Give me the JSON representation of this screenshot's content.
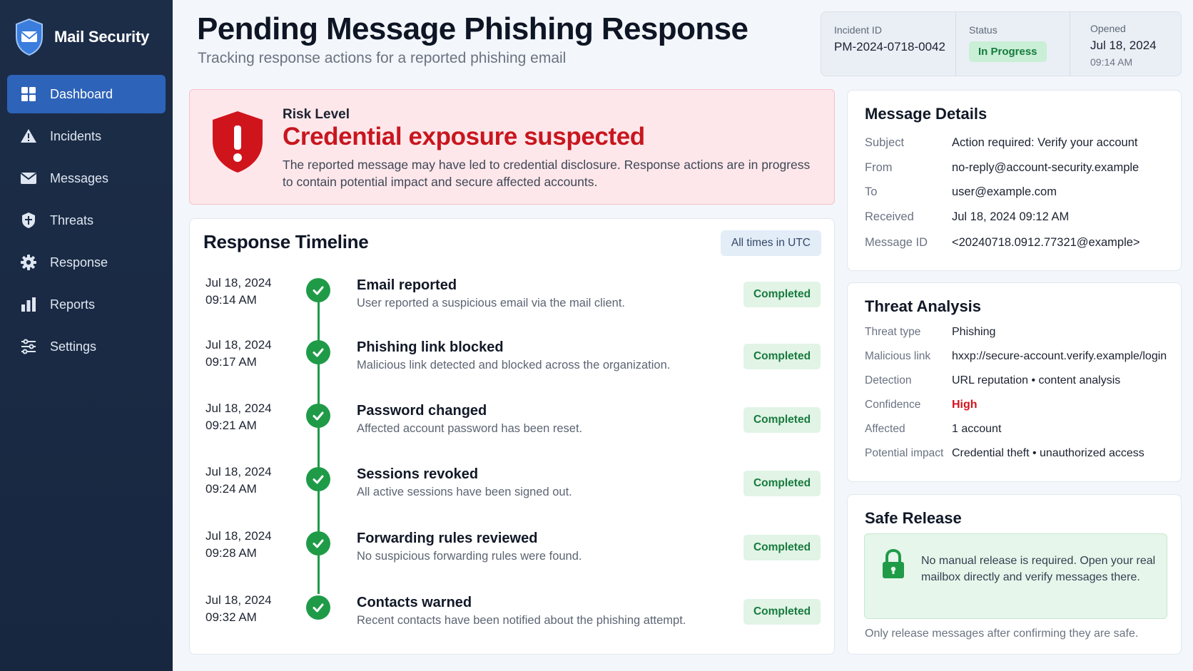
{
  "app": {
    "name": "Mail Security"
  },
  "sidebar": {
    "items": [
      {
        "label": "Dashboard",
        "icon": "dashboard-grid-icon",
        "active": true
      },
      {
        "label": "Incidents",
        "icon": "warning-triangle-icon",
        "active": false
      },
      {
        "label": "Messages",
        "icon": "envelope-icon",
        "active": false
      },
      {
        "label": "Threats",
        "icon": "shield-icon",
        "active": false
      },
      {
        "label": "Response",
        "icon": "gear-icon",
        "active": false
      },
      {
        "label": "Reports",
        "icon": "bar-chart-icon",
        "active": false
      },
      {
        "label": "Settings",
        "icon": "sliders-icon",
        "active": false
      }
    ]
  },
  "header": {
    "title": "Pending Message Phishing Response",
    "subtitle": "Tracking response actions for a reported phishing email"
  },
  "incident": {
    "id_label": "Incident ID",
    "id_value": "PM-2024-0718-0042",
    "status_label": "Status",
    "status_value": "In Progress",
    "opened_label": "Opened",
    "opened_date": "Jul 18, 2024",
    "opened_time": "09:14 AM"
  },
  "risk": {
    "label": "Risk Level",
    "headline": "Credential exposure suspected",
    "description": "The reported message may have led to credential disclosure. Response actions are in progress to contain potential impact and secure affected accounts."
  },
  "timeline": {
    "title": "Response Timeline",
    "timezone_note": "All times in UTC",
    "events": [
      {
        "date": "Jul 18, 2024",
        "time": "09:14 AM",
        "title": "Email reported",
        "description": "User reported a suspicious email via the mail client.",
        "status": "Completed"
      },
      {
        "date": "Jul 18, 2024",
        "time": "09:17 AM",
        "title": "Phishing link blocked",
        "description": "Malicious link detected and blocked across the organization.",
        "status": "Completed"
      },
      {
        "date": "Jul 18, 2024",
        "time": "09:21 AM",
        "title": "Password changed",
        "description": "Affected account password has been reset.",
        "status": "Completed"
      },
      {
        "date": "Jul 18, 2024",
        "time": "09:24 AM",
        "title": "Sessions revoked",
        "description": "All active sessions have been signed out.",
        "status": "Completed"
      },
      {
        "date": "Jul 18, 2024",
        "time": "09:28 AM",
        "title": "Forwarding rules reviewed",
        "description": "No suspicious forwarding rules were found.",
        "status": "Completed"
      },
      {
        "date": "Jul 18, 2024",
        "time": "09:32 AM",
        "title": "Contacts warned",
        "description": "Recent contacts have been notified about the phishing attempt.",
        "status": "Completed"
      }
    ]
  },
  "message_details": {
    "title": "Message Details",
    "rows": [
      {
        "key": "Subject",
        "value": "Action required: Verify your account"
      },
      {
        "key": "From",
        "value": "no-reply@account-security.example"
      },
      {
        "key": "To",
        "value": "user@example.com"
      },
      {
        "key": "Received",
        "value": "Jul 18, 2024 09:12 AM"
      },
      {
        "key": "Message ID",
        "value": "<20240718.0912.77321@example>"
      }
    ]
  },
  "threat_analysis": {
    "title": "Threat Analysis",
    "rows": [
      {
        "key": "Threat type",
        "value": "Phishing"
      },
      {
        "key": "Malicious link",
        "value": "hxxp://secure-account.verify.example/login"
      },
      {
        "key": "Detection",
        "value": "URL reputation • content analysis"
      },
      {
        "key": "Confidence",
        "value": "High"
      },
      {
        "key": "Affected",
        "value": "1 account"
      },
      {
        "key": "Potential impact",
        "value": "Credential theft • unauthorized access"
      }
    ]
  },
  "safe_release": {
    "title": "Safe Release",
    "message": "No manual release is required. Open your real mailbox directly and verify messages there.",
    "note": "Only release messages after confirming they are safe."
  },
  "colors": {
    "sidebar_bg": "#1c2d48",
    "active_nav": "#2d63b8",
    "danger": "#c8161f",
    "success": "#1f9b48"
  }
}
